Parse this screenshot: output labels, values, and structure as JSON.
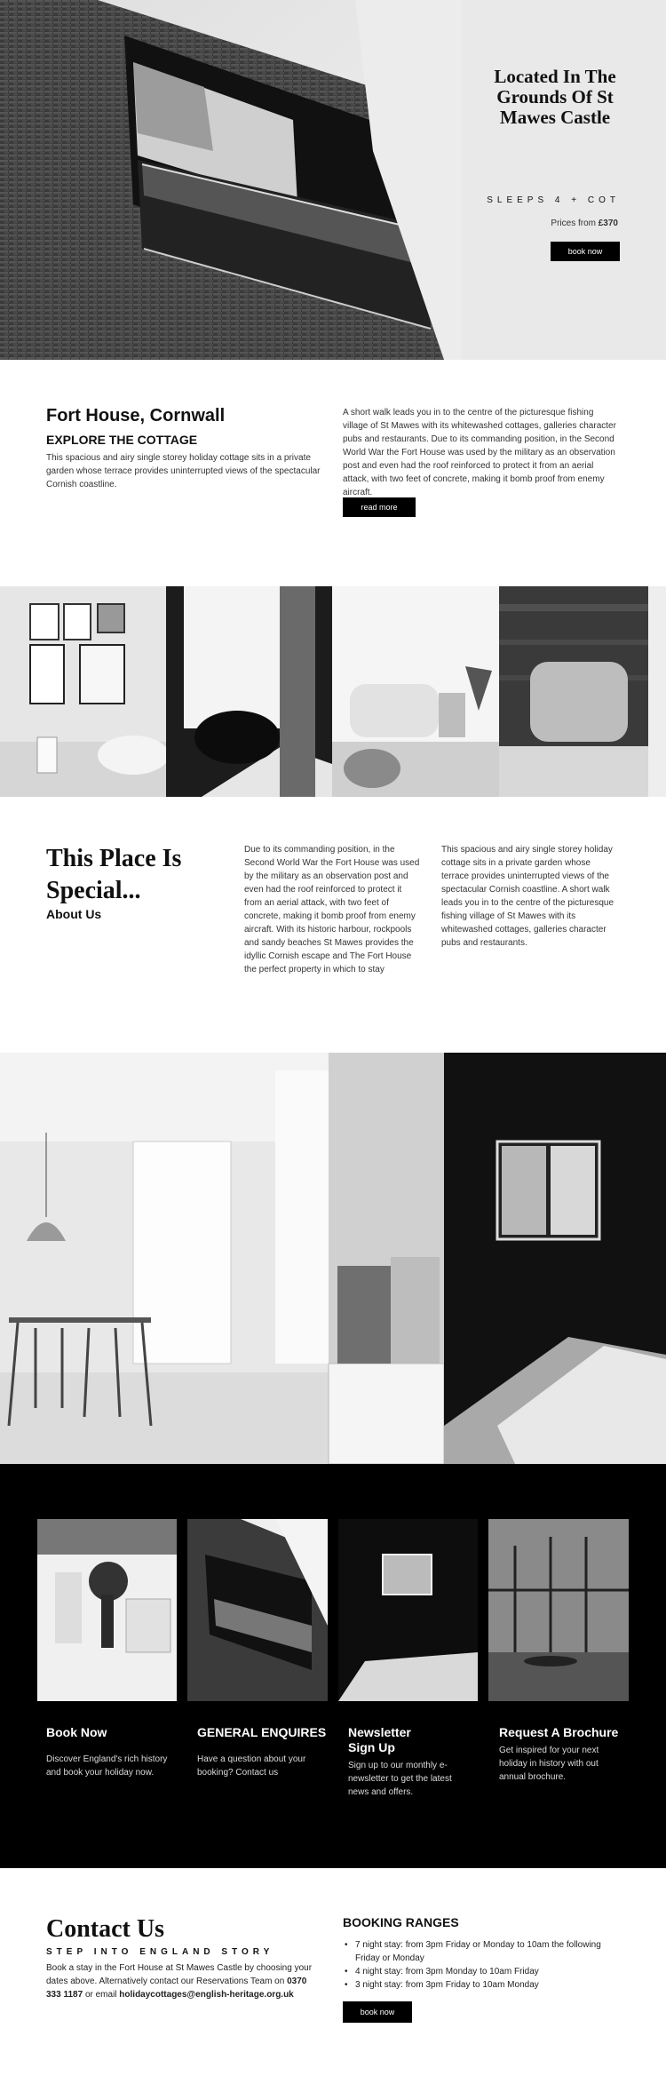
{
  "hero": {
    "title_lines": [
      "Located In The",
      "Grounds Of St",
      "Mawes Castle"
    ],
    "sleeps": "SLEEPS 4 + COT",
    "price_prefix": "Prices from ",
    "price": "£370",
    "button": "book now"
  },
  "intro": {
    "title": "Fort House, Cornwall",
    "subtitle": "EXPLORE THE COTTAGE",
    "text": "This spacious and airy single storey holiday cottage sits in a private garden whose terrace provides uninterrupted views of the spectacular Cornish coastline.",
    "right_text": "A short walk leads you in to the centre of the picturesque fishing village of St Mawes with its whitewashed cottages, galleries character pubs and restaurants. Due to its commanding position, in the Second World War the Fort House was used by the military as an observation post and even had the roof reinforced to protect it from an aerial attack, with two feet of concrete, making it bomb proof from enemy aircraft.",
    "button": "read more"
  },
  "special": {
    "title_lines": [
      "This Place Is",
      "Special..."
    ],
    "subtitle": "About Us",
    "col1": "Due to its commanding position, in the Second World War the Fort House was used by the military as an observation post and even had the roof reinforced to protect it from an aerial attack, with two feet of concrete, making it bomb proof from enemy aircraft. With its historic harbour, rockpools and sandy beaches St Mawes provides the idyllic Cornish escape and The Fort House the perfect property in which to stay",
    "col2": "This spacious and airy single storey holiday cottage sits in a private garden whose terrace provides uninterrupted views of the spectacular Cornish coastline. A short walk leads you in to the centre of the picturesque fishing village of St Mawes with its whitewashed cottages, galleries character pubs and restaurants."
  },
  "cards": [
    {
      "title": "Book Now",
      "text": "Discover England's rich history and book your holiday now."
    },
    {
      "title": "GENERAL ENQUIRES",
      "text": "Have a question about your booking? Contact us"
    },
    {
      "title": "Newsletter Sign Up",
      "text": "Sign up to our monthly e-newsletter to get the latest news and offers."
    },
    {
      "title": "Request A Brochure",
      "text": "Get inspired for your next holiday in history with out annual brochure."
    }
  ],
  "contact": {
    "title": "Contact Us",
    "tagline": "STEP INTO ENGLAND STORY",
    "text": "Book a stay in the Fort House at St Mawes Castle by choosing your dates above. Alternatively contact our Reservations Team on",
    "phone": "0370 333 1187",
    "or_email": " or email ",
    "email": "holidaycottages@english-heritage.org.uk",
    "ranges_title": "BOOKING RANGES",
    "ranges": [
      "7 night stay: from 3pm Friday or Monday to 10am the following Friday or Monday",
      "4 night stay: from 3pm Monday to 10am Friday",
      "3 night stay: from 3pm Friday to 10am Monday"
    ],
    "button": "book now"
  },
  "colors": {
    "accent": "#000000",
    "background": "#ffffff",
    "dark_section": "#000000"
  }
}
